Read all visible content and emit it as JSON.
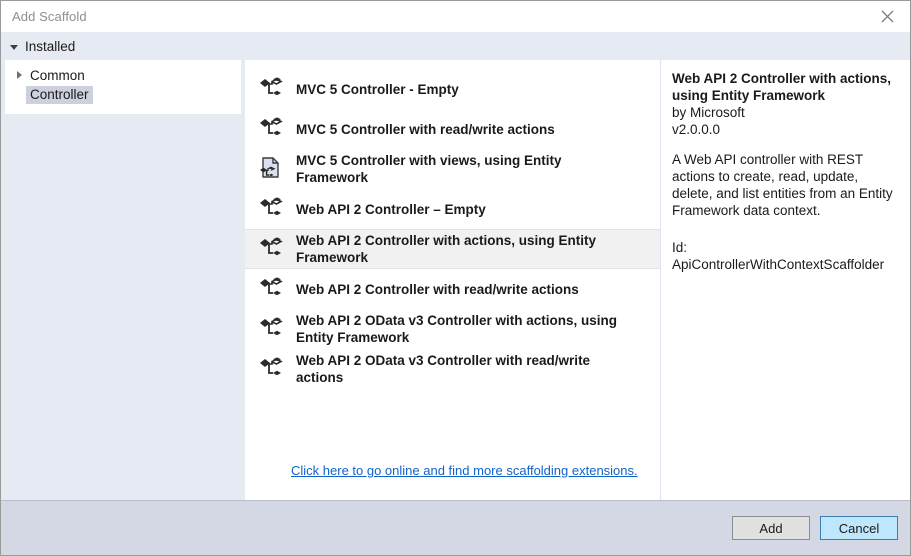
{
  "window": {
    "title": "Add Scaffold",
    "close_icon": "close-icon"
  },
  "installed_bar": {
    "label": "Installed",
    "expander_icon": "triangle-down-icon"
  },
  "sidebar": {
    "items": [
      {
        "label": "Common",
        "expander_icon": "triangle-right-icon",
        "selected": false
      },
      {
        "label": "Controller",
        "expander_icon": "",
        "selected": true
      }
    ]
  },
  "list": {
    "rows": [
      {
        "label": "MVC 5 Controller - Empty",
        "icon": "scaffold-icon",
        "selected": false
      },
      {
        "label": "MVC 5 Controller with read/write actions",
        "icon": "scaffold-icon",
        "selected": false
      },
      {
        "label": "MVC 5 Controller with views, using Entity Framework",
        "icon": "scaffold-page-icon",
        "selected": false
      },
      {
        "label": "Web API 2 Controller – Empty",
        "icon": "scaffold-icon",
        "selected": false
      },
      {
        "label": "Web API 2 Controller with actions, using Entity Framework",
        "icon": "scaffold-icon",
        "selected": true
      },
      {
        "label": "Web API 2 Controller with read/write actions",
        "icon": "scaffold-icon",
        "selected": false
      },
      {
        "label": "Web API 2 OData v3 Controller with actions, using Entity Framework",
        "icon": "scaffold-icon",
        "selected": false
      },
      {
        "label": "Web API 2 OData v3 Controller with read/write actions",
        "icon": "scaffold-icon",
        "selected": false
      }
    ],
    "more_link": "Click here to go online and find more scaffolding extensions."
  },
  "detail": {
    "title": "Web API 2 Controller with actions, using Entity Framework",
    "author": "by Microsoft",
    "version": "v2.0.0.0",
    "description": "A Web API controller with REST actions to create, read, update, delete, and list entities from an Entity Framework data context.",
    "id": "Id: ApiControllerWithContextScaffolder"
  },
  "footer": {
    "add_label": "Add",
    "cancel_label": "Cancel"
  },
  "colors": {
    "link": "#1263c8",
    "installed_bar_bg": "#e6eaf2",
    "footer_bg": "#d3d8e4",
    "selected_row_bg": "#f1f1f1",
    "tree_selection_bg": "#cdd0dd",
    "focus_button_bg": "#bee6fd",
    "focus_button_border": "#3c7fb1"
  }
}
